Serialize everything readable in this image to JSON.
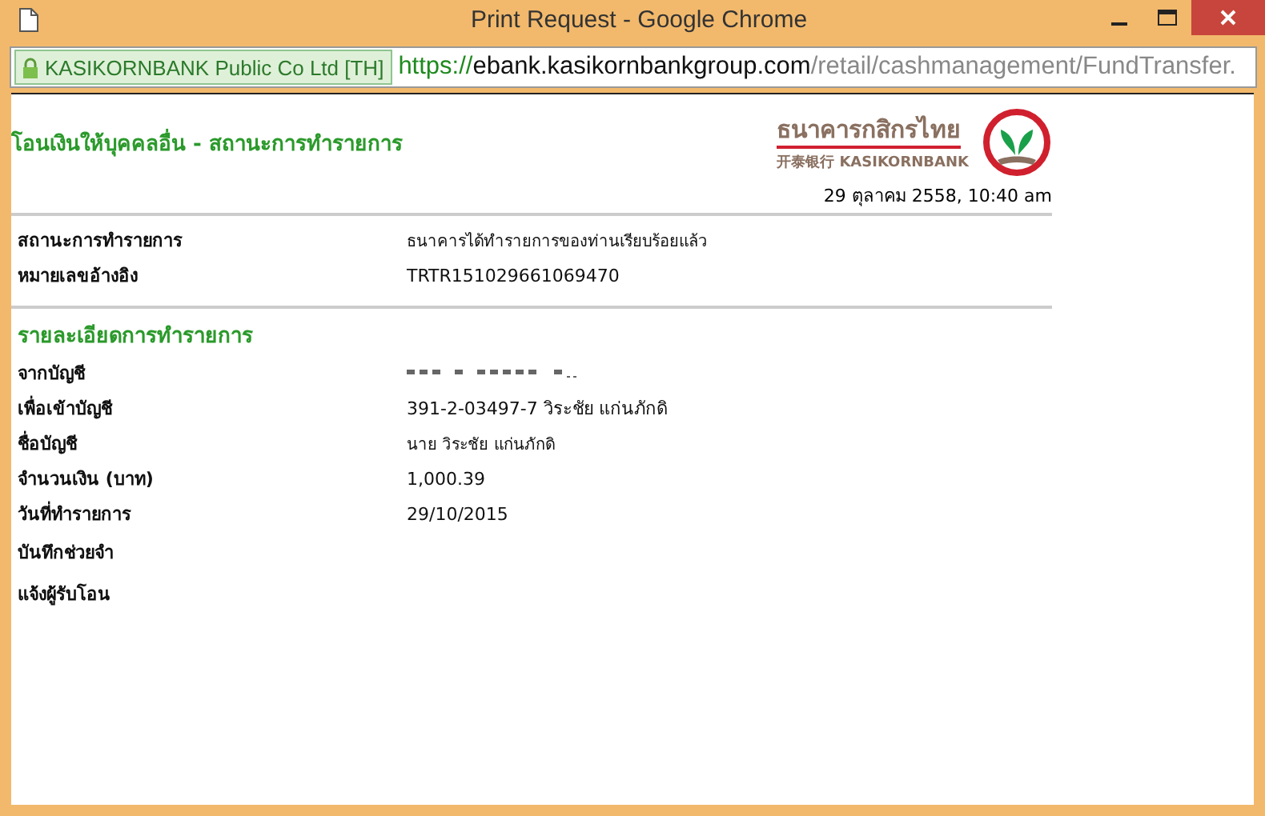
{
  "window": {
    "title": "Print Request - Google Chrome"
  },
  "address_bar": {
    "certificate": "KASIKORNBANK Public Co Ltd [TH]",
    "scheme": "https://",
    "host": "ebank.kasikornbankgroup.com",
    "path": "/retail/cashmanagement/FundTransfer."
  },
  "page": {
    "heading": "โอนเงินให้บุคคลอื่น - สถานะการทำรายการ",
    "logo_thai": "ธนาคารกสิกรไทย",
    "logo_sub": "开泰银行 KASIKORNBANK",
    "timestamp": "29 ตุลาคม 2558, 10:40 am"
  },
  "status_rows": [
    {
      "label": "สถานะการทำรายการ",
      "value": "ธนาคารได้ทำรายการของท่านเรียบร้อยแล้ว",
      "kind": "small"
    },
    {
      "label": "หมายเลขอ้างอิง",
      "value": "TRTR151029661069470",
      "kind": "text"
    }
  ],
  "details": {
    "title": "รายละเอียดการทำรายการ",
    "rows": [
      {
        "label": "จากบัญชี",
        "kind": "redacted"
      },
      {
        "label": "เพื่อเข้าบัญชี",
        "value": "391-2-03497-7 วิระชัย แก่นภักดิ",
        "kind": "text"
      },
      {
        "label": "ชื่อบัญชี",
        "value": "นาย วิระชัย แก่นภักดิ",
        "kind": "small"
      },
      {
        "label": "จำนวนเงิน (บาท)",
        "value": "1,000.39",
        "kind": "text"
      },
      {
        "label": "วันที่ทำรายการ",
        "value": "29/10/2015",
        "kind": "text"
      },
      {
        "label": "บันทึกช่วยจำ",
        "kind": "empty"
      },
      {
        "label": "แจ้งผู้รับโอน",
        "kind": "empty"
      }
    ]
  }
}
